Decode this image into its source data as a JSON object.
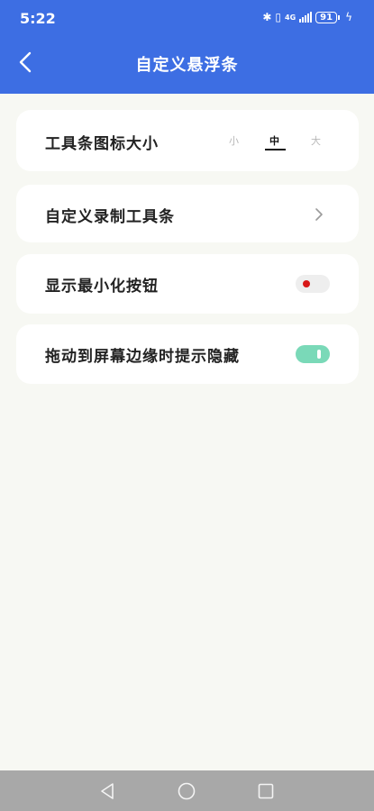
{
  "status_bar": {
    "time": "5:22",
    "network": "4G",
    "battery": "91",
    "icons": [
      "bluetooth-icon",
      "vibrate-icon",
      "signal-icon",
      "battery-icon",
      "charging-icon"
    ]
  },
  "header": {
    "title": "自定义悬浮条",
    "back_icon": "chevron-left-icon"
  },
  "settings": {
    "icon_size": {
      "label": "工具条图标大小",
      "options": [
        "小",
        "中",
        "大"
      ],
      "selected": "中"
    },
    "custom_toolbar": {
      "label": "自定义录制工具条",
      "icon": "chevron-right-icon"
    },
    "show_minimize": {
      "label": "显示最小化按钮",
      "enabled": false
    },
    "hide_hint": {
      "label": "拖动到屏幕边缘时提示隐藏",
      "enabled": true
    }
  },
  "colors": {
    "header_bg": "#3d6ee3",
    "page_bg": "#f7f8f3",
    "toggle_on": "#7ad9b8",
    "toggle_off_knob": "#d71818"
  },
  "navbar": {
    "icons": [
      "back-triangle-icon",
      "home-circle-icon",
      "recents-square-icon"
    ]
  }
}
